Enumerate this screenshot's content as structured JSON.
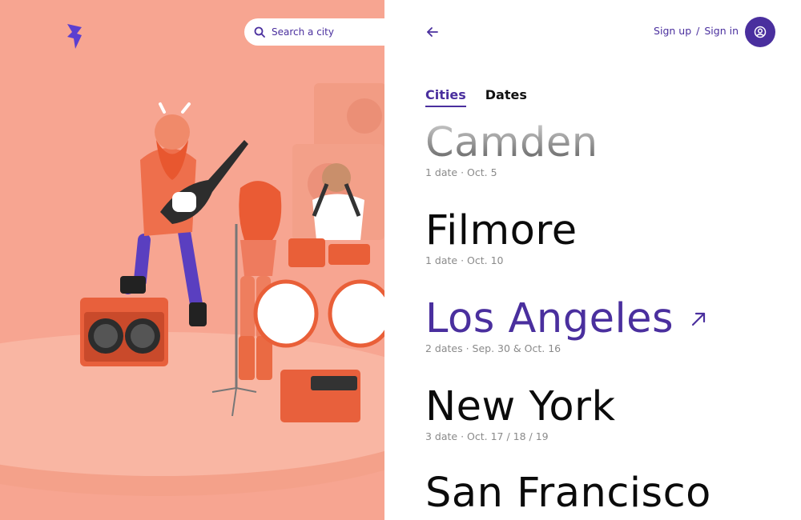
{
  "search": {
    "placeholder": "Search a city"
  },
  "header": {
    "sign_up": "Sign up",
    "separator": "/",
    "sign_in": "Sign in"
  },
  "tabs": [
    {
      "label": "Cities",
      "active": true
    },
    {
      "label": "Dates",
      "active": false
    }
  ],
  "cities": [
    {
      "name": "Camden",
      "info": "1 date · Oct. 5",
      "state": "faded"
    },
    {
      "name": "Filmore",
      "info": "1 date · Oct. 10",
      "state": "normal"
    },
    {
      "name": "Los Angeles",
      "info": "2 dates · Sep. 30 & Oct. 16",
      "state": "highlighted"
    },
    {
      "name": "New York",
      "info": "3 date · Oct. 17 / 18 / 19",
      "state": "normal"
    },
    {
      "name": "San Francisco",
      "info": "",
      "state": "normal"
    }
  ],
  "colors": {
    "accent": "#4a2f9e",
    "hero_background": "#f7a591",
    "text": "#0b0b0b",
    "muted": "#8a8a8a"
  },
  "icons": [
    "logo-bolt-icon",
    "search-icon",
    "back-arrow-icon",
    "user-icon",
    "arrow-up-right-icon"
  ]
}
